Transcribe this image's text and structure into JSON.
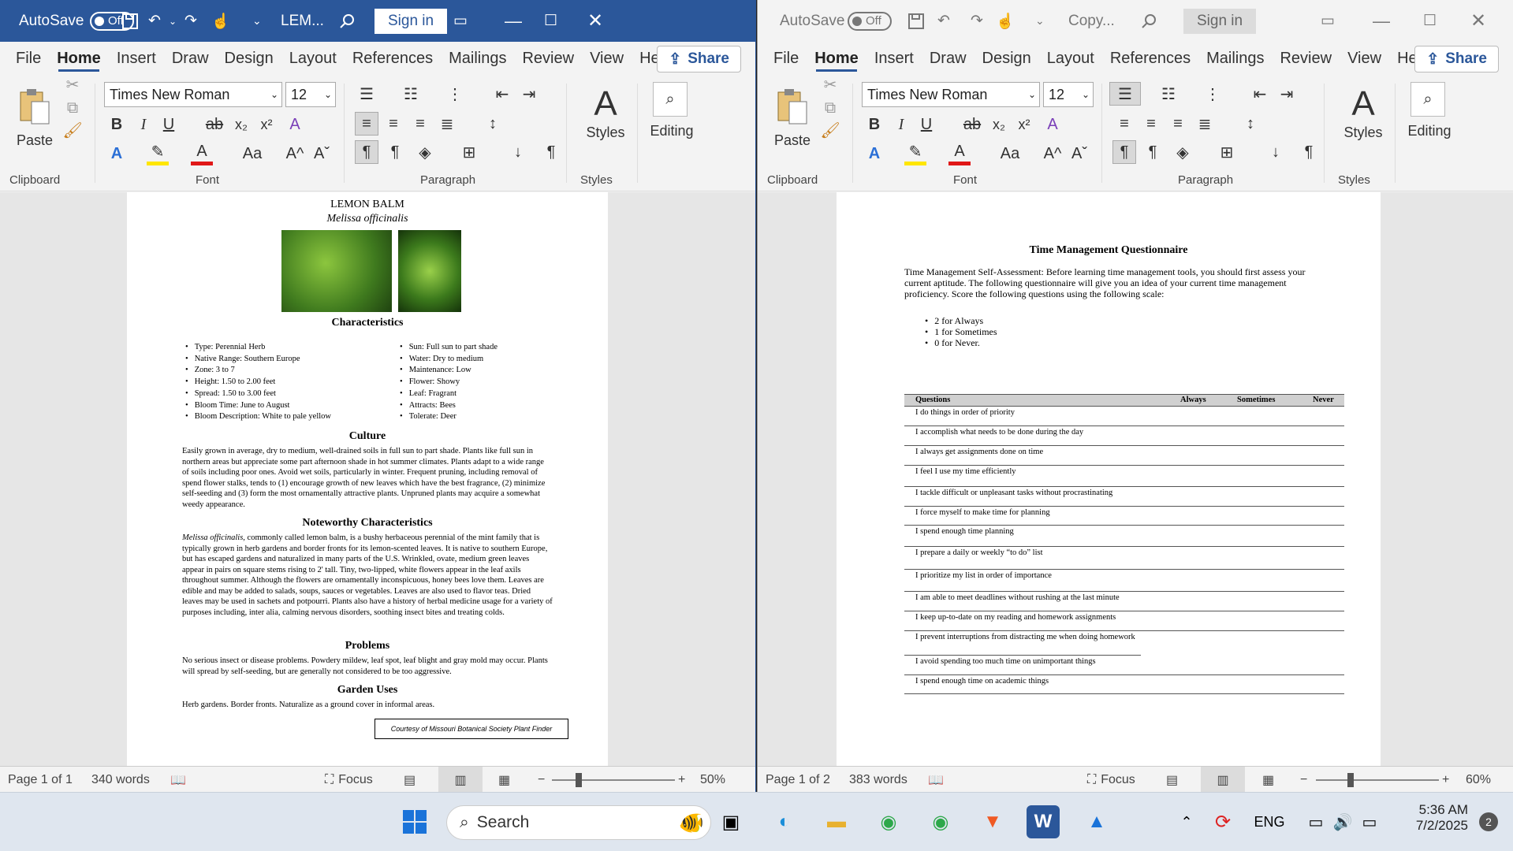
{
  "left_window": {
    "autosave_label": "AutoSave",
    "autosave_state": "Off",
    "doc_title": "LEM...",
    "signin": "Sign in",
    "tabs": [
      "File",
      "Home",
      "Insert",
      "Draw",
      "Design",
      "Layout",
      "References",
      "Mailings",
      "Review",
      "View",
      "Help"
    ],
    "share": "Share",
    "font_name": "Times New Roman",
    "font_size": "12",
    "groups": {
      "clipboard": "Clipboard",
      "font": "Font",
      "paragraph": "Paragraph",
      "styles": "Styles"
    },
    "paste": "Paste",
    "styles_btn": "Styles",
    "editing_btn": "Editing",
    "status": {
      "page": "Page 1 of 1",
      "words": "340 words",
      "focus": "Focus",
      "zoom": "50%"
    }
  },
  "right_window": {
    "autosave_label": "AutoSave",
    "autosave_state": "Off",
    "doc_title": "Copy...",
    "signin": "Sign in",
    "tabs": [
      "File",
      "Home",
      "Insert",
      "Draw",
      "Design",
      "Layout",
      "References",
      "Mailings",
      "Review",
      "View",
      "Help"
    ],
    "share": "Share",
    "font_name": "Times New Roman",
    "font_size": "12",
    "groups": {
      "clipboard": "Clipboard",
      "font": "Font",
      "paragraph": "Paragraph",
      "styles": "Styles"
    },
    "paste": "Paste",
    "styles_btn": "Styles",
    "editing_btn": "Editing",
    "status": {
      "page": "Page 1 of 2",
      "words": "383 words",
      "focus": "Focus",
      "zoom": "60%"
    }
  },
  "lemon_doc": {
    "title": "LEMON BALM",
    "subtitle": "Melissa officinalis",
    "characteristics_heading": "Characteristics",
    "char_left": [
      "Type: Perennial Herb",
      "Native Range: Southern Europe",
      "Zone: 3 to 7",
      "Height: 1.50 to 2.00 feet",
      "Spread: 1.50 to 3.00 feet",
      "Bloom Time: June to August",
      "Bloom Description: White to pale yellow"
    ],
    "char_right": [
      "Sun: Full sun to part shade",
      "Water: Dry to medium",
      "Maintenance: Low",
      "Flower: Showy",
      "Leaf: Fragrant",
      "Attracts: Bees",
      "Tolerate: Deer"
    ],
    "culture_heading": "Culture",
    "culture_text": "Easily grown in average, dry to medium, well-drained soils in full sun to part shade. Plants like full sun in northern areas but appreciate some part afternoon shade in hot summer climates. Plants adapt to a wide range of soils including poor ones. Avoid wet soils, particularly in winter. Frequent pruning, including removal of spend flower stalks, tends to (1) encourage growth of new leaves which have the best fragrance, (2) minimize self-seeding and (3) form the most ornamentally attractive plants. Unpruned plants may acquire a somewhat weedy appearance.",
    "noteworthy_heading": "Noteworthy Characteristics",
    "noteworthy_italic": "Melissa officinalis",
    "noteworthy_text": ", commonly called lemon balm, is a bushy herbaceous perennial of the mint family that is typically grown in herb gardens and border fronts for its lemon-scented leaves. It is native to southern Europe, but has escaped gardens and naturalized in many parts of the U.S. Wrinkled, ovate, medium green leaves appear in pairs on square stems rising to 2' tall. Tiny, two-lipped, white flowers appear in the leaf axils throughout summer. Although the flowers are ornamentally inconspicuous, honey bees love them. Leaves are edible and may be added to salads, soups, sauces or vegetables. Leaves are also used to flavor teas. Dried leaves may be used in sachets and potpourri. Plants also have a history of herbal medicine usage for a variety of purposes including, inter alia, calming nervous disorders, soothing insect bites and treating colds.",
    "problems_heading": "Problems",
    "problems_text": "No serious insect or disease problems. Powdery mildew, leaf spot, leaf blight and gray mold may occur. Plants will spread by self-seeding, but are generally not considered to be too aggressive.",
    "garden_heading": "Garden Uses",
    "garden_text": "Herb gardens. Border fronts. Naturalize as a ground cover in informal areas.",
    "courtesy": "Courtesy of Missouri Botanical Society Plant Finder"
  },
  "tm_doc": {
    "title": "Time Management Questionnaire",
    "intro": "Time Management Self-Assessment: Before learning time management tools, you should first assess your current aptitude. The following questionnaire will give you an idea of your current time management proficiency. Score the following questions using the following scale:",
    "scale": [
      "2 for Always",
      "1 for Sometimes",
      "0 for Never."
    ],
    "headers": [
      "Questions",
      "Always",
      "Sometimes",
      "Never"
    ],
    "questions": [
      "I do things in order of priority",
      "I accomplish what needs to be done during the day",
      "I always get assignments done on time",
      "I feel I use my time efficiently",
      "I tackle difficult or unpleasant tasks without procrastinating",
      "I force myself to make time for planning",
      "I spend enough time planning",
      "I prepare a daily or weekly “to do” list",
      "I prioritize my list in order of importance",
      "I am able to meet deadlines without rushing at the last minute",
      "I keep up-to-date on my reading and homework assignments",
      "I prevent interruptions from distracting me when doing homework",
      "I avoid spending too much time on unimportant things",
      "I spend enough time on academic things"
    ]
  },
  "taskbar": {
    "search": "Search",
    "lang": "ENG",
    "time": "5:36 AM",
    "date": "7/2/2025",
    "notif_count": "2"
  },
  "colors": {
    "word_blue": "#2b579a",
    "taskbar": "#dfe6ef"
  }
}
